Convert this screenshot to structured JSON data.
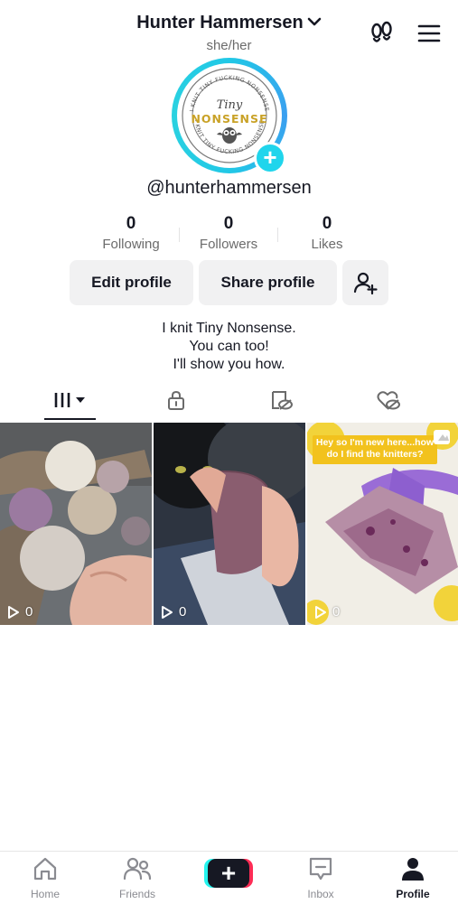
{
  "header": {
    "display_name": "Hunter Hammersen",
    "pronouns": "she/her"
  },
  "avatar": {
    "ring_text_top": "I KNIT TINY FUCKING NONSENSE",
    "logo_script": "Tiny",
    "logo_word": "NONSENSE",
    "ring_text_bottom": "I KNIT TINY FUCKING NONSENSE",
    "plus": "+"
  },
  "profile": {
    "handle": "@hunterhammersen"
  },
  "stats": [
    {
      "value": "0",
      "label": "Following"
    },
    {
      "value": "0",
      "label": "Followers"
    },
    {
      "value": "0",
      "label": "Likes"
    }
  ],
  "buttons": {
    "edit_profile": "Edit profile",
    "share_profile": "Share profile"
  },
  "bio": {
    "lines": [
      "I knit Tiny Nonsense.",
      "You can too!",
      "I'll show you how."
    ]
  },
  "tabs": [
    "videos-grid-icon",
    "private-lock-icon",
    "reposts-icon",
    "liked-icon"
  ],
  "videos": [
    {
      "views": "0",
      "caption": ""
    },
    {
      "views": "0",
      "caption": ""
    },
    {
      "views": "0",
      "caption": "Hey so I'm new here...how do I find the knitters?"
    }
  ],
  "nav": [
    {
      "label": "Home"
    },
    {
      "label": "Friends"
    },
    {
      "label": "+"
    },
    {
      "label": "Inbox"
    },
    {
      "label": "Profile"
    }
  ],
  "colors": {
    "accent_cyan": "#20d5ec",
    "logo_gold": "#c9a227",
    "tiktok_red": "#fe2c55",
    "tiktok_cyan": "#25f4ee"
  }
}
